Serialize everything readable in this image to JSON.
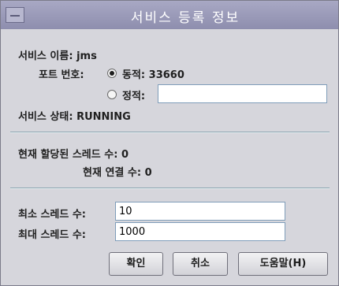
{
  "window": {
    "title": "서비스 등록 정보"
  },
  "service": {
    "name_label": "서비스 이름:",
    "name_value": "jms",
    "port_label": "포트 번호:",
    "dynamic_label": "동적:",
    "dynamic_value": "33660",
    "static_label": "정적:",
    "static_value": "",
    "state_label": "서비스 상태:",
    "state_value": "RUNNING"
  },
  "threads": {
    "allocated_label": "현재 할당된 스레드 수:",
    "allocated_value": "0",
    "connections_label": "현재 연결 수:",
    "connections_value": "0"
  },
  "settings": {
    "min_label": "최소 스레드 수:",
    "min_value": "10",
    "max_label": "최대 스레드 수:",
    "max_value": "1000"
  },
  "buttons": {
    "ok": "확인",
    "cancel": "취소",
    "help": "도움말(H)"
  }
}
